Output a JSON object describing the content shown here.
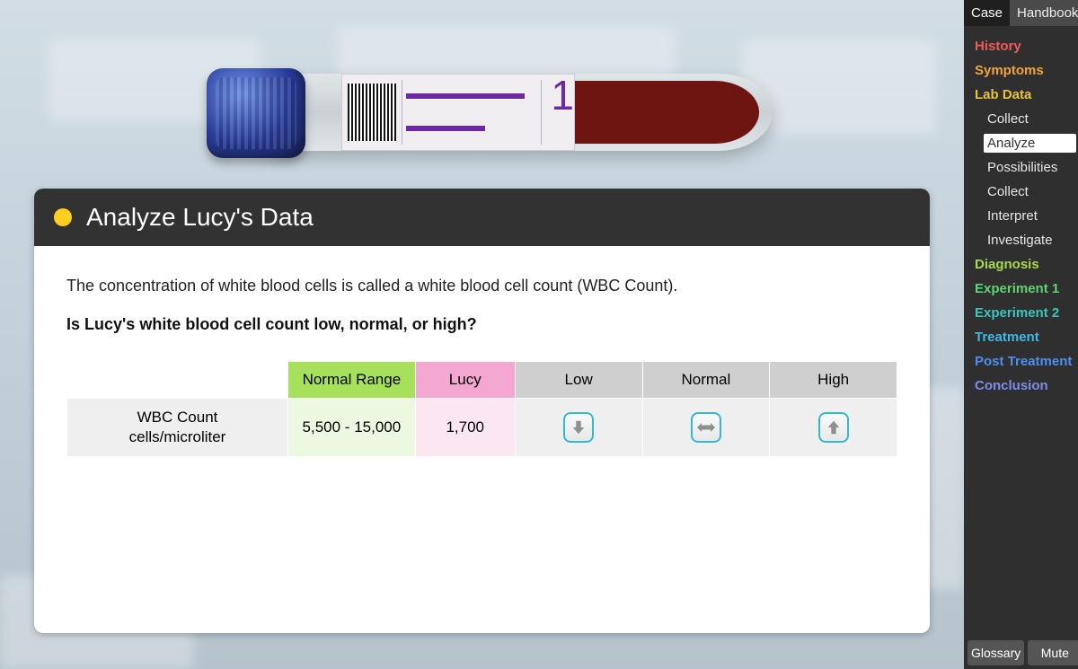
{
  "tube": {
    "sample_number": "1"
  },
  "card": {
    "title": "Analyze Lucy's Data",
    "intro": "The concentration of white blood cells is called a white blood cell count (WBC Count).",
    "question": "Is Lucy's white blood cell count low, normal, or high?"
  },
  "table": {
    "headers": {
      "normal_range": "Normal Range",
      "subject": "Lucy",
      "low": "Low",
      "normal": "Normal",
      "high": "High"
    },
    "row": {
      "label_line1": "WBC Count",
      "label_line2": "cells/microliter",
      "normal_range": "5,500 - 15,000",
      "subject_value": "1,700"
    }
  },
  "sidebar": {
    "tabs": {
      "case": "Case",
      "handbook": "Handbook"
    },
    "items": [
      {
        "label": "History",
        "color": "c-red"
      },
      {
        "label": "Symptoms",
        "color": "c-orange"
      },
      {
        "label": "Lab Data",
        "color": "c-yellow"
      },
      {
        "label": "Diagnosis",
        "color": "c-lime"
      },
      {
        "label": "Experiment 1",
        "color": "c-green"
      },
      {
        "label": "Experiment 2",
        "color": "c-teal"
      },
      {
        "label": "Treatment",
        "color": "c-cyan"
      },
      {
        "label": "Post Treatment",
        "color": "c-blue"
      },
      {
        "label": "Conclusion",
        "color": "c-indigo"
      }
    ],
    "labdata_subitems": [
      {
        "label": "Collect"
      },
      {
        "label": "Analyze",
        "active": true
      },
      {
        "label": "Possibilities"
      },
      {
        "label": "Collect"
      },
      {
        "label": "Interpret"
      },
      {
        "label": "Investigate"
      }
    ],
    "footer": {
      "glossary": "Glossary",
      "mute": "Mute"
    }
  }
}
